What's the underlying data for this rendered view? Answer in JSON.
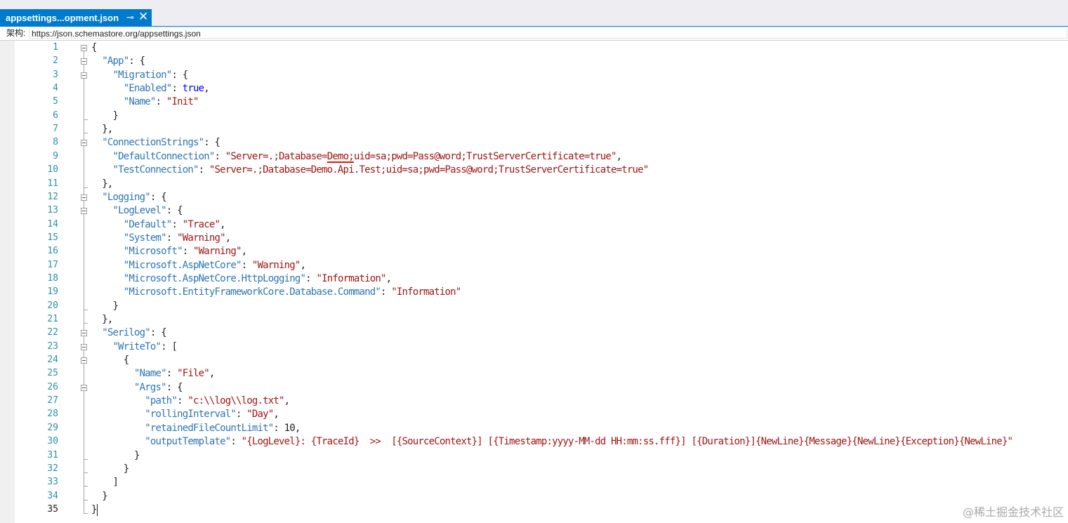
{
  "tab": {
    "title": "appsettings...opment.json",
    "pin_glyph": "⊸",
    "close_glyph": "✕"
  },
  "schema": {
    "label": "架构:",
    "url": "https://json.schemastore.org/appsettings.json"
  },
  "editor": {
    "current_line": 35,
    "lines": [
      {
        "n": 1,
        "tokens": [
          [
            "p",
            "{"
          ]
        ]
      },
      {
        "n": 2,
        "tokens": [
          [
            "p",
            "  "
          ],
          [
            "k",
            "\"App\""
          ],
          [
            "p",
            ": {"
          ]
        ]
      },
      {
        "n": 3,
        "tokens": [
          [
            "p",
            "    "
          ],
          [
            "k",
            "\"Migration\""
          ],
          [
            "p",
            ": {"
          ]
        ]
      },
      {
        "n": 4,
        "tokens": [
          [
            "p",
            "      "
          ],
          [
            "k",
            "\"Enabled\""
          ],
          [
            "p",
            ": "
          ],
          [
            "b",
            "true"
          ],
          [
            "p",
            ","
          ]
        ]
      },
      {
        "n": 5,
        "tokens": [
          [
            "p",
            "      "
          ],
          [
            "k",
            "\"Name\""
          ],
          [
            "p",
            ": "
          ],
          [
            "s",
            "\"Init\""
          ]
        ]
      },
      {
        "n": 6,
        "tokens": [
          [
            "p",
            "    }"
          ]
        ]
      },
      {
        "n": 7,
        "tokens": [
          [
            "p",
            "  },"
          ]
        ]
      },
      {
        "n": 8,
        "tokens": [
          [
            "p",
            "  "
          ],
          [
            "k",
            "\"ConnectionStrings\""
          ],
          [
            "p",
            ": {"
          ]
        ]
      },
      {
        "n": 9,
        "tokens": [
          [
            "p",
            "    "
          ],
          [
            "k",
            "\"DefaultConnection\""
          ],
          [
            "p",
            ": "
          ],
          [
            "s",
            "\"Server=.;Database="
          ],
          [
            "s squiggle",
            "Demo;"
          ],
          [
            "s",
            "uid=sa;pwd=Pass@word;TrustServerCertificate=true\""
          ],
          [
            "p",
            ","
          ]
        ]
      },
      {
        "n": 10,
        "tokens": [
          [
            "p",
            "    "
          ],
          [
            "k",
            "\"TestConnection\""
          ],
          [
            "p",
            ": "
          ],
          [
            "s",
            "\"Server=.;Database=Demo.Api.Test;uid=sa;pwd=Pass@word;TrustServerCertificate=true\""
          ]
        ]
      },
      {
        "n": 11,
        "tokens": [
          [
            "p",
            "  },"
          ]
        ]
      },
      {
        "n": 12,
        "tokens": [
          [
            "p",
            "  "
          ],
          [
            "k",
            "\"Logging\""
          ],
          [
            "p",
            ": {"
          ]
        ]
      },
      {
        "n": 13,
        "tokens": [
          [
            "p",
            "    "
          ],
          [
            "k",
            "\"LogLevel\""
          ],
          [
            "p",
            ": {"
          ]
        ]
      },
      {
        "n": 14,
        "tokens": [
          [
            "p",
            "      "
          ],
          [
            "k",
            "\"Default\""
          ],
          [
            "p",
            ": "
          ],
          [
            "s",
            "\"Trace\""
          ],
          [
            "p",
            ","
          ]
        ]
      },
      {
        "n": 15,
        "tokens": [
          [
            "p",
            "      "
          ],
          [
            "k",
            "\"System\""
          ],
          [
            "p",
            ": "
          ],
          [
            "s",
            "\"Warning\""
          ],
          [
            "p",
            ","
          ]
        ]
      },
      {
        "n": 16,
        "tokens": [
          [
            "p",
            "      "
          ],
          [
            "k",
            "\"Microsoft\""
          ],
          [
            "p",
            ": "
          ],
          [
            "s",
            "\"Warning\""
          ],
          [
            "p",
            ","
          ]
        ]
      },
      {
        "n": 17,
        "tokens": [
          [
            "p",
            "      "
          ],
          [
            "k",
            "\"Microsoft.AspNetCore\""
          ],
          [
            "p",
            ": "
          ],
          [
            "s",
            "\"Warning\""
          ],
          [
            "p",
            ","
          ]
        ]
      },
      {
        "n": 18,
        "tokens": [
          [
            "p",
            "      "
          ],
          [
            "k",
            "\"Microsoft.AspNetCore.HttpLogging\""
          ],
          [
            "p",
            ": "
          ],
          [
            "s",
            "\"Information\""
          ],
          [
            "p",
            ","
          ]
        ]
      },
      {
        "n": 19,
        "tokens": [
          [
            "p",
            "      "
          ],
          [
            "k",
            "\"Microsoft.EntityFrameworkCore.Database.Command\""
          ],
          [
            "p",
            ": "
          ],
          [
            "s",
            "\"Information\""
          ]
        ]
      },
      {
        "n": 20,
        "tokens": [
          [
            "p",
            "    }"
          ]
        ]
      },
      {
        "n": 21,
        "tokens": [
          [
            "p",
            "  },"
          ]
        ]
      },
      {
        "n": 22,
        "tokens": [
          [
            "p",
            "  "
          ],
          [
            "k",
            "\"Serilog\""
          ],
          [
            "p",
            ": {"
          ]
        ]
      },
      {
        "n": 23,
        "tokens": [
          [
            "p",
            "    "
          ],
          [
            "k",
            "\"WriteTo\""
          ],
          [
            "p",
            ": ["
          ]
        ]
      },
      {
        "n": 24,
        "tokens": [
          [
            "p",
            "      {"
          ]
        ]
      },
      {
        "n": 25,
        "tokens": [
          [
            "p",
            "        "
          ],
          [
            "k",
            "\"Name\""
          ],
          [
            "p",
            ": "
          ],
          [
            "s",
            "\"File\""
          ],
          [
            "p",
            ","
          ]
        ]
      },
      {
        "n": 26,
        "tokens": [
          [
            "p",
            "        "
          ],
          [
            "k",
            "\"Args\""
          ],
          [
            "p",
            ": {"
          ]
        ]
      },
      {
        "n": 27,
        "tokens": [
          [
            "p",
            "          "
          ],
          [
            "k",
            "\"path\""
          ],
          [
            "p",
            ": "
          ],
          [
            "s",
            "\"c:\\\\log\\\\log.txt\""
          ],
          [
            "p",
            ","
          ]
        ]
      },
      {
        "n": 28,
        "tokens": [
          [
            "p",
            "          "
          ],
          [
            "k",
            "\"rollingInterval\""
          ],
          [
            "p",
            ": "
          ],
          [
            "s",
            "\"Day\""
          ],
          [
            "p",
            ","
          ]
        ]
      },
      {
        "n": 29,
        "tokens": [
          [
            "p",
            "          "
          ],
          [
            "k",
            "\"retainedFileCountLimit\""
          ],
          [
            "p",
            ": 10,"
          ]
        ]
      },
      {
        "n": 30,
        "tokens": [
          [
            "p",
            "          "
          ],
          [
            "k",
            "\"outputTemplate\""
          ],
          [
            "p",
            ": "
          ],
          [
            "s",
            "\"{LogLevel}: {TraceId}  >>  [{SourceContext}] [{Timestamp:yyyy-MM-dd HH:mm:ss.fff}] [{Duration}]{NewLine}{Message}{NewLine}{Exception}{NewLine}\""
          ]
        ]
      },
      {
        "n": 31,
        "tokens": [
          [
            "p",
            "        }"
          ]
        ]
      },
      {
        "n": 32,
        "tokens": [
          [
            "p",
            "      }"
          ]
        ]
      },
      {
        "n": 33,
        "tokens": [
          [
            "p",
            "    ]"
          ]
        ]
      },
      {
        "n": 34,
        "tokens": [
          [
            "p",
            "  }"
          ]
        ]
      },
      {
        "n": 35,
        "tokens": [
          [
            "p",
            "}"
          ]
        ]
      }
    ],
    "folds": [
      {
        "start": 1,
        "end": 35
      },
      {
        "start": 2,
        "end": 7
      },
      {
        "start": 3,
        "end": 6
      },
      {
        "start": 8,
        "end": 11
      },
      {
        "start": 12,
        "end": 21
      },
      {
        "start": 13,
        "end": 20
      },
      {
        "start": 22,
        "end": 34
      },
      {
        "start": 23,
        "end": 33
      },
      {
        "start": 24,
        "end": 32
      },
      {
        "start": 26,
        "end": 31
      }
    ]
  },
  "watermark": "@稀土掘金技术社区",
  "colors": {
    "tab_active": "#007acc",
    "line_number": "#2b91af",
    "json_key": "#2e75b6",
    "json_string": "#a31515",
    "json_keyword": "#0000ff",
    "squiggle": "#e51400"
  }
}
